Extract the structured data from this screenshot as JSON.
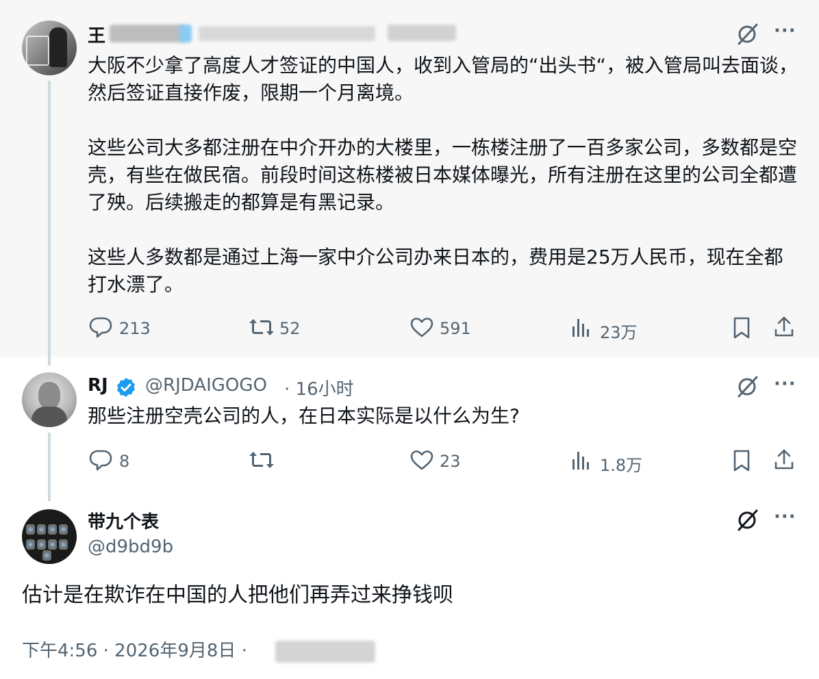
{
  "post1": {
    "name": "王",
    "body": "大阪不少拿了高度人才签证的中国人，收到入管局的“出头书“，被入管局叫去面谈，然后签证直接作废，限期一个月离境。\n\n这些公司大多都注册在中介开办的大楼里，一栋楼注册了一百多家公司，多数都是空壳，有些在做民宿。前段时间这栋楼被日本媒体曝光，所有注册在这里的公司全都遭了殃。后续搬走的都算是有黑记录。\n\n这些人多数都是通过上海一家中介公司办来日本的，费用是25万人民币，现在全都打水漂了。",
    "replies": "213",
    "reposts": "52",
    "likes": "591",
    "views": "23万"
  },
  "post2": {
    "name": "RJ",
    "handle": "@RJDAIGOGO",
    "time": "· 16小时",
    "body": "那些注册空壳公司的人，在日本实际是以什么为生?",
    "replies": "8",
    "likes": "23",
    "views": "1.8万"
  },
  "post3": {
    "name": "带九个表",
    "handle": "@d9bd9b",
    "body": "估计是在欺诈在中国的人把他们再弄过来挣钱呗",
    "timestamp": "下午4:56 · 2026年9月8日 ·"
  },
  "icons": {
    "reply": "reply-icon",
    "repost": "repost-icon",
    "like": "like-icon",
    "views": "views-icon",
    "bookmark": "bookmark-icon",
    "share": "share-icon",
    "grok": "grok-icon",
    "more": "more-icon",
    "verified": "verified-badge-icon"
  },
  "colors": {
    "accent": "#1d9bf0",
    "secondary_text": "#536471",
    "thread_line": "#cfd9de",
    "highlight_bg": "#f7f7f7"
  }
}
